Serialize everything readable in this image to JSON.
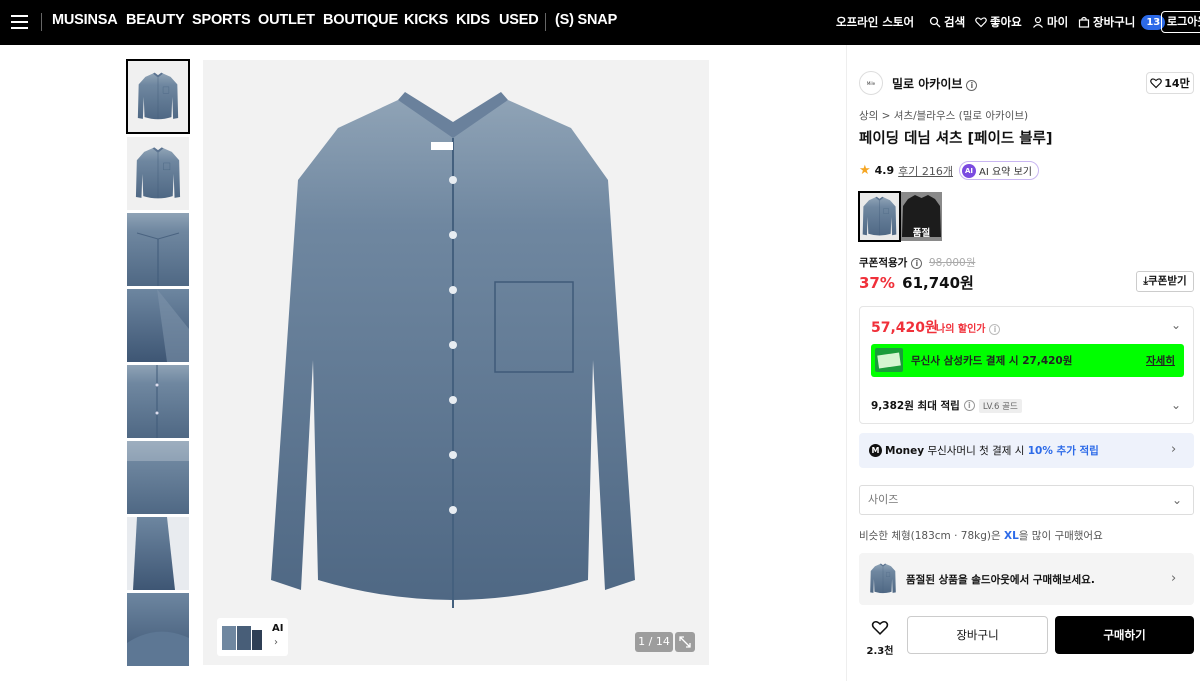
{
  "nav": {
    "menu_icon": "hamburger-icon",
    "items": [
      "MUSINSA",
      "BEAUTY",
      "SPORTS",
      "OUTLET",
      "BOUTIQUE",
      "KICKS",
      "KIDS",
      "USED"
    ],
    "snap": "(S) SNAP",
    "offline_store": "오프라인 스토어",
    "search": "검색",
    "likes": "좋아요",
    "my": "마이",
    "cart": "장바구니",
    "cart_count": "13",
    "login": "로그아웃"
  },
  "gallery": {
    "thumbnail_count": 8,
    "counter": "1 / 14",
    "ai_label": "AI",
    "ai_chevron": "›",
    "expand_icon": "expand-icon"
  },
  "product": {
    "brand_logo_text": "Mile Archive",
    "brand": "밀로 아카이브",
    "likes": "14만",
    "breadcrumb": "상의 > 셔츠/블라우스 (밀로 아카이브)",
    "title": "페이딩 데님 셔츠 [페이드 블루]",
    "rating": "4.9",
    "reviews": "후기 216개",
    "ai_summary_badge": "AI",
    "ai_summary": "AI 요약 보기",
    "soldout_label": "품절",
    "coupon_price_label": "쿠폰적용가",
    "original_price": "98,000원",
    "discount_rate": "37%",
    "price": "61,740원",
    "coupon_button": "쿠폰받기",
    "coupon_icon": "download-icon"
  },
  "benefits": {
    "my_price": "57,420원",
    "my_price_label": "나의 할인가",
    "card_offer": "무신사 삼성카드 결제 시 27,420원",
    "card_detail": "자세히",
    "points": "9,382원 최대 적립",
    "level": "LV.6 골드",
    "money_logo": "M",
    "money_brand": "Money",
    "money_text": "무신사머니 첫 결제 시",
    "money_highlight": "10% 추가 적립"
  },
  "size": {
    "placeholder": "사이즈",
    "hint_prefix": "비슷한 체형(183cm · 78kg)은",
    "hint_size": "XL",
    "hint_suffix": "을 많이 구매했어요"
  },
  "soldout_banner": "품절된 상품을 솔드아웃에서 구매해보세요.",
  "actions": {
    "like_count": "2.3천",
    "cart": "장바구니",
    "buy": "구매하기"
  },
  "colors": {
    "accent_red": "#f0303a",
    "accent_blue": "#2c6ae8",
    "card_green": "#00ff00"
  }
}
